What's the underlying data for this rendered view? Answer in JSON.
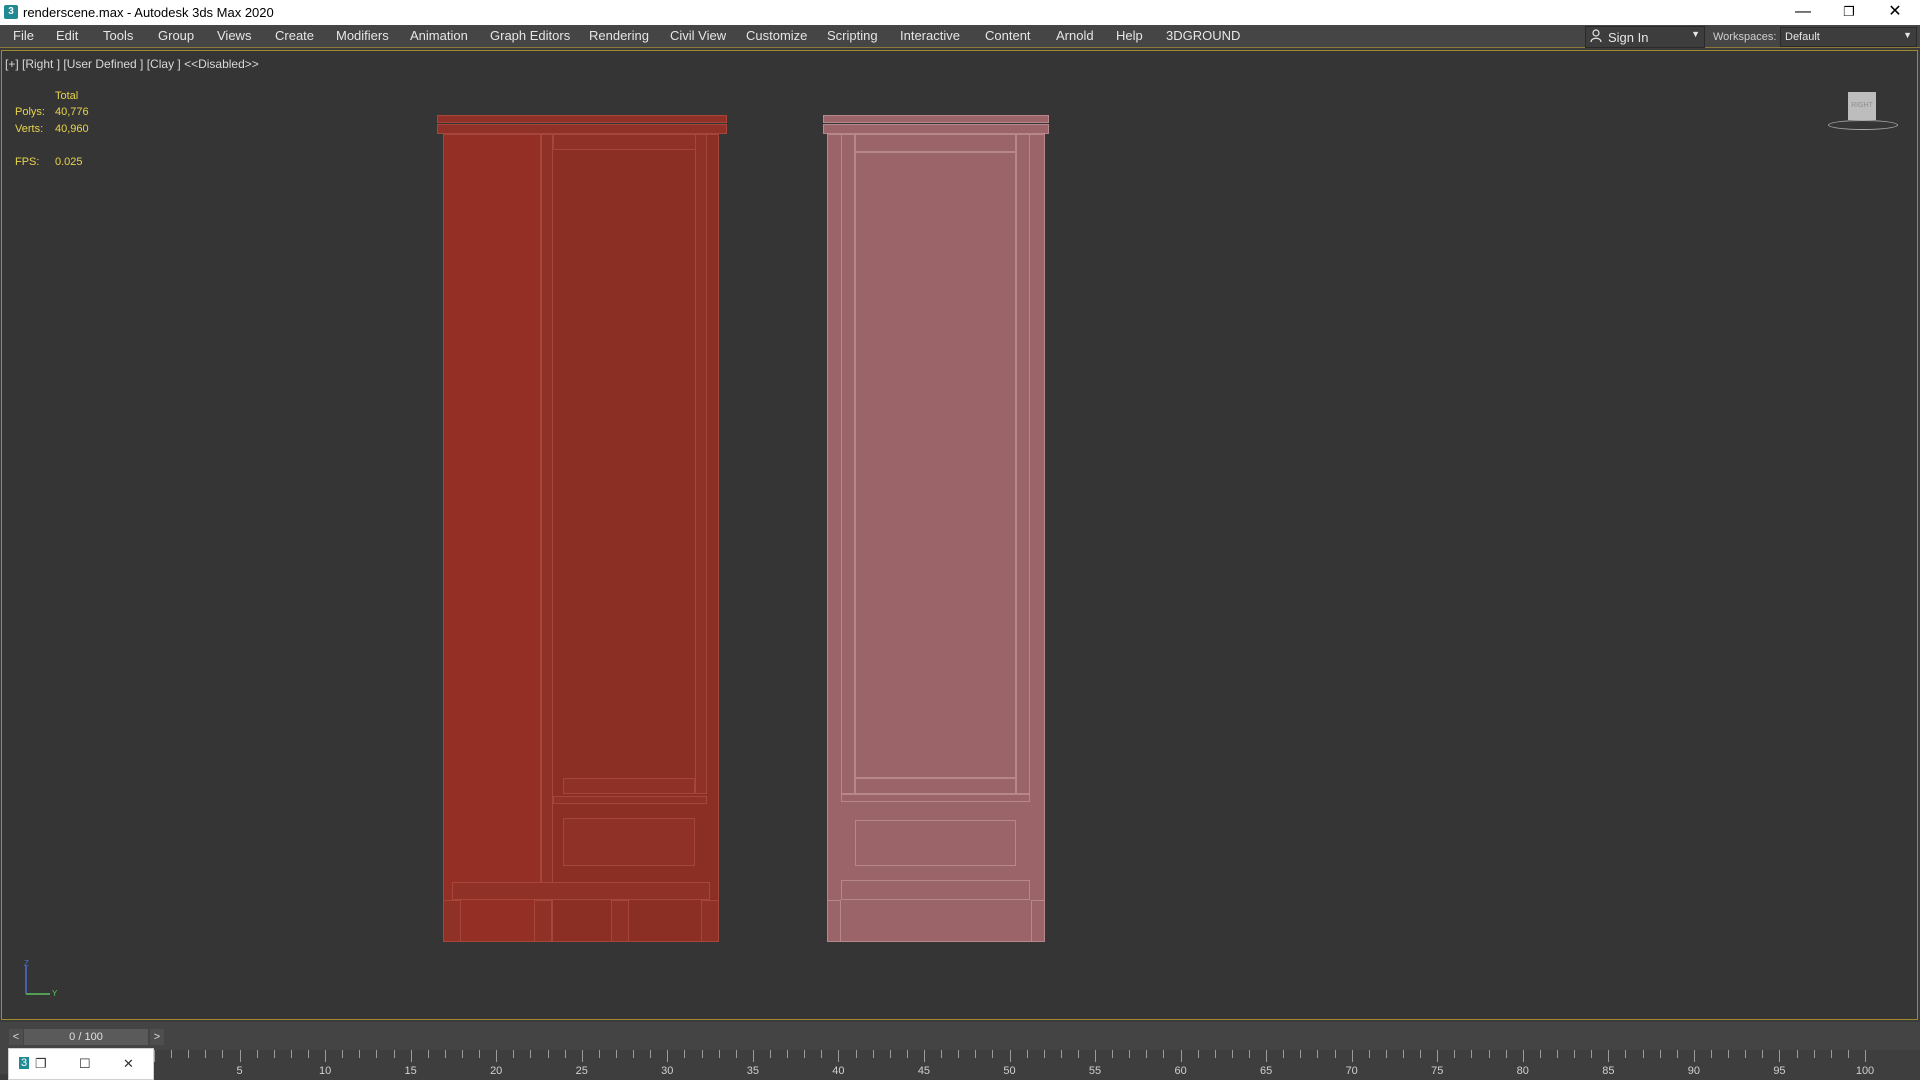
{
  "window": {
    "title": "renderscene.max - Autodesk 3ds Max 2020",
    "app_icon": "3ds-max-icon",
    "controls": {
      "minimize": "—",
      "restore": "❐",
      "close": "✕"
    }
  },
  "menu": {
    "items": [
      "File",
      "Edit",
      "Tools",
      "Group",
      "Views",
      "Create",
      "Modifiers",
      "Animation",
      "Graph Editors",
      "Rendering",
      "Civil View",
      "Customize",
      "Scripting",
      "Interactive",
      "Content",
      "Arnold",
      "Help",
      "3DGROUND"
    ]
  },
  "account": {
    "sign_in_label": "Sign In",
    "icon": "user-icon"
  },
  "workspaces": {
    "label": "Workspaces:",
    "value": "Default"
  },
  "viewport": {
    "label": "[+] [Right ] [User Defined ] [Clay ]  <<Disabled>>",
    "stats": {
      "total_label": "Total",
      "polys_label": "Polys:",
      "polys_value": "40,776",
      "verts_label": "Verts:",
      "verts_value": "40,960",
      "fps_label": "FPS:",
      "fps_value": "0.025"
    },
    "viewcube_label": "RIGHT",
    "axis": {
      "z": "Z",
      "y": "Y"
    },
    "colors": {
      "wardrobe_left": "#8f3126",
      "wardrobe_right": "#9a6469",
      "stats_text": "#e8d44d"
    }
  },
  "timeline": {
    "frame_label": "0 / 100",
    "prev": "<",
    "next": ">",
    "ruler_labels": [
      "5",
      "10",
      "15",
      "20",
      "25",
      "30",
      "35",
      "40",
      "45",
      "50",
      "55",
      "60",
      "65",
      "70",
      "75",
      "80",
      "85",
      "90",
      "95",
      "100"
    ]
  },
  "taskbar_window": {
    "icons": [
      "3ds-max-icon",
      "restore-icon",
      "maximize-icon",
      "close-icon"
    ]
  }
}
